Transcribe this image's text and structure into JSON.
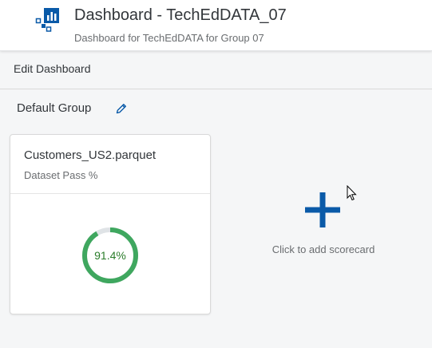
{
  "header": {
    "title": "Dashboard - TechEdDATA_07",
    "subtitle": "Dashboard for TechEdDATA for Group 07",
    "icon": "dashboard-app-icon"
  },
  "toolbar": {
    "edit_label": "Edit Dashboard"
  },
  "group": {
    "title": "Default Group",
    "edit_icon": "pencil-icon"
  },
  "scorecard": {
    "title": "Customers_US2.parquet",
    "subtitle": "Dataset Pass %",
    "value_label": "91.4%",
    "value": 91.4,
    "color": "#3fa75f",
    "track_color": "#dfe3e6"
  },
  "add_scorecard": {
    "label": "Click to add scorecard",
    "icon": "plus-icon",
    "color": "#0a5aa8"
  },
  "colors": {
    "brand": "#0a5aa8",
    "background": "#f5f6f7"
  }
}
